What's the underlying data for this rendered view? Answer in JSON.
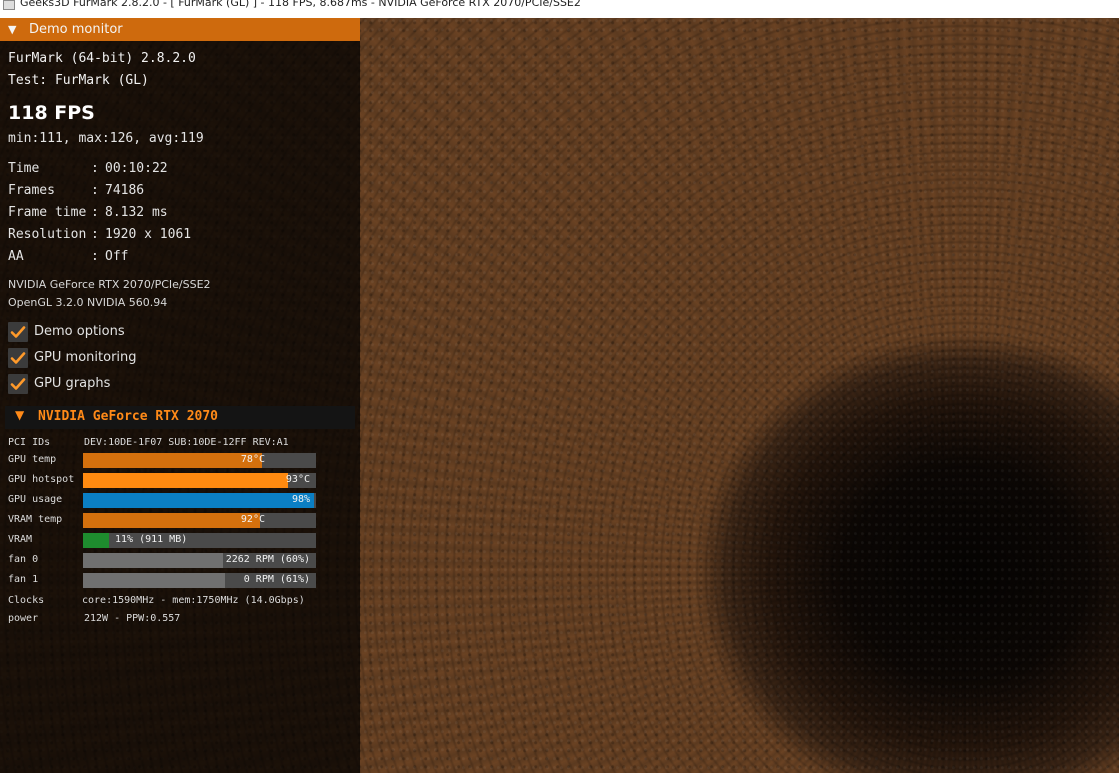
{
  "titlebar": {
    "title": "Geeks3D FurMark 2.8.2.0 - [ FurMark (GL) ] - 118 FPS, 8.687ms - NVIDIA GeForce RTX 2070/PCIe/SSE2",
    "icon": "app-icon"
  },
  "panel": {
    "header": {
      "triangle": "▼",
      "label": "Demo monitor"
    },
    "app_name": "FurMark (64-bit) 2.8.2.0",
    "test": "Test: FurMark (GL)",
    "fps": "118 FPS",
    "fps_stats": "min:111, max:126, avg:119",
    "stats": [
      {
        "label": "Time",
        "value": "00:10:22"
      },
      {
        "label": "Frames",
        "value": "74186"
      },
      {
        "label": "Frame time",
        "value": "8.132 ms"
      },
      {
        "label": "Resolution",
        "value": "1920 x 1061"
      },
      {
        "label": "AA",
        "value": "Off"
      }
    ],
    "stat_colon": ":",
    "gpu_renderer": "NVIDIA GeForce RTX 2070/PCIe/SSE2",
    "gl_version": "OpenGL 3.2.0 NVIDIA 560.94",
    "options": [
      {
        "label": "Demo options",
        "checked": true
      },
      {
        "label": "GPU monitoring",
        "checked": true
      },
      {
        "label": "GPU graphs",
        "checked": true
      }
    ]
  },
  "gpu": {
    "header": {
      "triangle": "▼",
      "name": "NVIDIA GeForce RTX 2070"
    },
    "pci": {
      "label": "PCI IDs",
      "value": "DEV:10DE-1F07 SUB:10DE-12FF REV:A1"
    },
    "bars": [
      {
        "label": "GPU temp",
        "text": "78°C",
        "fill": 0.77,
        "color": "#d4700d",
        "align": "rightmid"
      },
      {
        "label": "GPU hotspot",
        "text": "93°C",
        "fill": 0.88,
        "color": "#ff8a10",
        "align": "right"
      },
      {
        "label": "GPU usage",
        "text": "98%",
        "fill": 0.99,
        "color": "#0b7fc4",
        "align": "right"
      },
      {
        "label": "VRAM temp",
        "text": "92°C",
        "fill": 0.76,
        "color": "#d4700d",
        "align": "rightmid"
      },
      {
        "label": "VRAM",
        "text": "11% (911 MB)",
        "fill": 0.11,
        "color": "#1e8c2e",
        "align": "left"
      },
      {
        "label": "fan 0",
        "text": "2262 RPM (60%)",
        "fill": 0.6,
        "color": "#707070",
        "align": "right"
      },
      {
        "label": "fan 1",
        "text": "0 RPM (61%)",
        "fill": 0.61,
        "color": "#707070",
        "align": "right"
      }
    ],
    "clocks": {
      "label": "Clocks",
      "value": "core:1590MHz - mem:1750MHz (14.0Gbps)"
    },
    "power": {
      "label": "power",
      "value": "212W - PPW:0.557"
    }
  }
}
